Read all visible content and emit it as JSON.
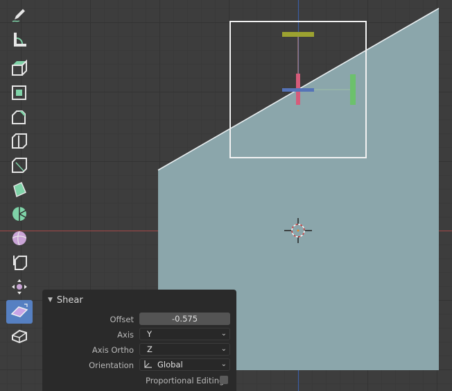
{
  "viewport": {
    "grid_color": "#3d3d3d",
    "object_color": "#8ba6ab",
    "x_axis_color": "#b34a4a",
    "y_axis_color": "#3e5fa8"
  },
  "toolbar": {
    "items": [
      {
        "name": "annotate-tool",
        "icon": "pencil-icon"
      },
      {
        "name": "measure-tool",
        "icon": "ruler-icon"
      },
      {
        "name": "extrude-region-tool",
        "icon": "extrude-icon"
      },
      {
        "name": "inset-faces-tool",
        "icon": "inset-icon"
      },
      {
        "name": "bevel-tool",
        "icon": "bevel-icon"
      },
      {
        "name": "loop-cut-tool",
        "icon": "loop-cut-icon"
      },
      {
        "name": "knife-tool",
        "icon": "knife-icon"
      },
      {
        "name": "poly-build-tool",
        "icon": "poly-build-icon"
      },
      {
        "name": "spin-tool",
        "icon": "spin-icon"
      },
      {
        "name": "smooth-tool",
        "icon": "smooth-icon"
      },
      {
        "name": "edge-slide-tool",
        "icon": "edge-slide-icon"
      },
      {
        "name": "shrink-fatten-tool",
        "icon": "shrink-fatten-icon"
      },
      {
        "name": "shear-tool",
        "icon": "shear-icon",
        "active": true
      },
      {
        "name": "rip-region-tool",
        "icon": "rip-icon"
      }
    ]
  },
  "operator_panel": {
    "title": "Shear",
    "offset_label": "Offset",
    "offset_value": "-0.575",
    "axis_label": "Axis",
    "axis_value": "Y",
    "axis_ortho_label": "Axis Ortho",
    "axis_ortho_value": "Z",
    "orientation_label": "Orientation",
    "orientation_value": "Global",
    "proportional_label": "Proportional Editing",
    "proportional_checked": false
  }
}
